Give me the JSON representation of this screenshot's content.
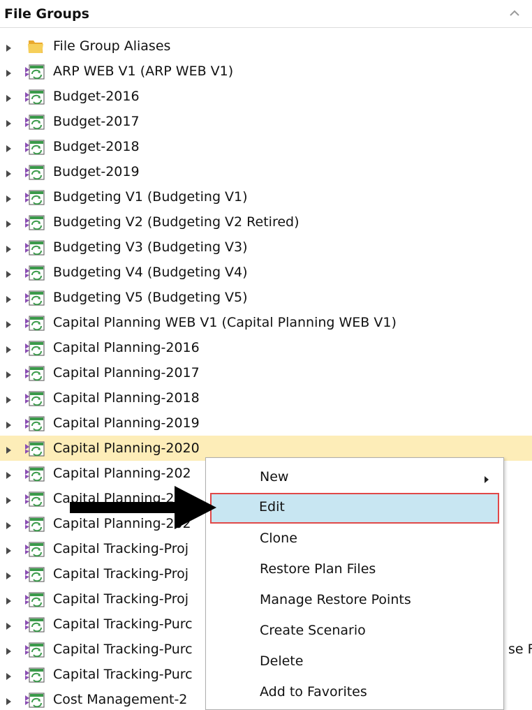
{
  "panel": {
    "title": "File Groups",
    "collapse_icon": "chevron-up-icon"
  },
  "tree": {
    "items": [
      {
        "label": "File Group Aliases",
        "icon": "folder-icon"
      },
      {
        "label": "ARP WEB V1 (ARP WEB V1)",
        "icon": "file-group-icon"
      },
      {
        "label": "Budget-2016",
        "icon": "file-group-icon"
      },
      {
        "label": "Budget-2017",
        "icon": "file-group-icon"
      },
      {
        "label": "Budget-2018",
        "icon": "file-group-icon"
      },
      {
        "label": "Budget-2019",
        "icon": "file-group-icon"
      },
      {
        "label": "Budgeting V1 (Budgeting V1)",
        "icon": "file-group-icon"
      },
      {
        "label": "Budgeting V2 (Budgeting V2 Retired)",
        "icon": "file-group-icon"
      },
      {
        "label": "Budgeting V3 (Budgeting V3)",
        "icon": "file-group-icon"
      },
      {
        "label": "Budgeting V4 (Budgeting V4)",
        "icon": "file-group-icon"
      },
      {
        "label": "Budgeting V5 (Budgeting V5)",
        "icon": "file-group-icon"
      },
      {
        "label": "Capital Planning WEB V1 (Capital Planning WEB V1)",
        "icon": "file-group-icon"
      },
      {
        "label": "Capital Planning-2016",
        "icon": "file-group-icon"
      },
      {
        "label": "Capital Planning-2017",
        "icon": "file-group-icon"
      },
      {
        "label": "Capital Planning-2018",
        "icon": "file-group-icon"
      },
      {
        "label": "Capital Planning-2019",
        "icon": "file-group-icon"
      },
      {
        "label": "Capital Planning-2020",
        "icon": "file-group-icon",
        "selected": true
      },
      {
        "label": "Capital Planning-202",
        "icon": "file-group-icon"
      },
      {
        "label": "Capital Planning-202",
        "icon": "file-group-icon"
      },
      {
        "label": "Capital Planning-202",
        "icon": "file-group-icon"
      },
      {
        "label": "Capital Tracking-Proj",
        "icon": "file-group-icon"
      },
      {
        "label": "Capital Tracking-Proj",
        "icon": "file-group-icon"
      },
      {
        "label": "Capital Tracking-Proj",
        "icon": "file-group-icon"
      },
      {
        "label": "Capital Tracking-Purc",
        "icon": "file-group-icon"
      },
      {
        "label": "Capital Tracking-Purc",
        "icon": "file-group-icon",
        "trailing_text": "se F"
      },
      {
        "label": "Capital Tracking-Purc",
        "icon": "file-group-icon"
      },
      {
        "label": "Cost Management-2",
        "icon": "file-group-icon"
      }
    ]
  },
  "context_menu": {
    "items": [
      {
        "label": "New",
        "has_submenu": true
      },
      {
        "label": "Edit",
        "highlighted": true
      },
      {
        "label": "Clone"
      },
      {
        "label": "Restore Plan Files"
      },
      {
        "label": "Manage Restore Points"
      },
      {
        "label": "Create Scenario"
      },
      {
        "label": "Delete"
      },
      {
        "label": "Add to Favorites"
      }
    ]
  },
  "annotation": {
    "arrow_color": "#000000",
    "highlight_border_color": "#e04848"
  },
  "colors": {
    "selected_row": "#fdedb8",
    "menu_highlight": "#c8e6f2",
    "folder": "#f2c14e",
    "file_group_green": "#3a9a4a",
    "file_group_purple": "#8b4fb3"
  }
}
